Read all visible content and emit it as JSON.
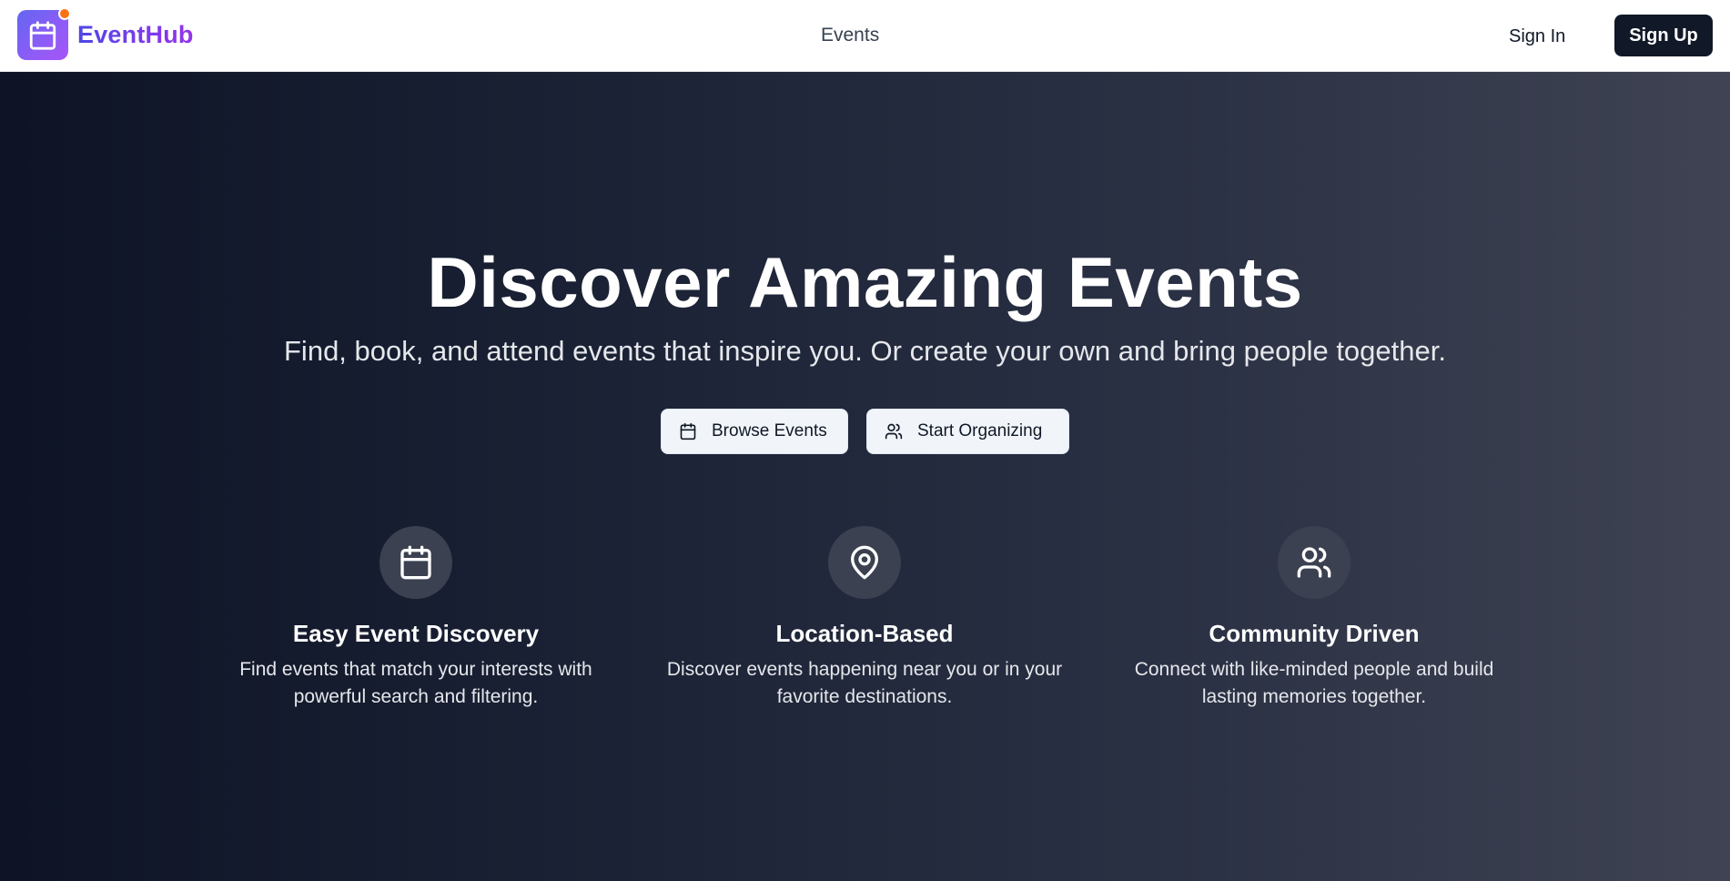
{
  "brand": {
    "name": "EventHub",
    "logo_icon": "calendar-icon",
    "notification_dot_color": "#f97316"
  },
  "nav": {
    "links": [
      {
        "label": "Events"
      }
    ],
    "sign_in": "Sign In",
    "sign_up": "Sign Up"
  },
  "hero": {
    "title": "Discover Amazing Events",
    "subtitle": "Find, book, and attend events that inspire you. Or create your own and bring people together.",
    "buttons": [
      {
        "label": "Browse Events",
        "icon": "calendar-icon"
      },
      {
        "label": "Start Organizing",
        "icon": "users-icon"
      }
    ]
  },
  "features": [
    {
      "icon": "calendar-icon",
      "title": "Easy Event Discovery",
      "description": "Find events that match your interests with powerful search and filtering."
    },
    {
      "icon": "map-pin-icon",
      "title": "Location-Based",
      "description": "Discover events happening near you or in your favorite destinations."
    },
    {
      "icon": "users-icon",
      "title": "Community Driven",
      "description": "Connect with like-minded people and build lasting memories together."
    }
  ],
  "colors": {
    "primary_dark": "#111827",
    "brand_gradient_start": "#6366f1",
    "brand_gradient_end": "#a855f7",
    "hero_gradient_start": "#0e1426",
    "hero_gradient_end": "#3f4353"
  }
}
